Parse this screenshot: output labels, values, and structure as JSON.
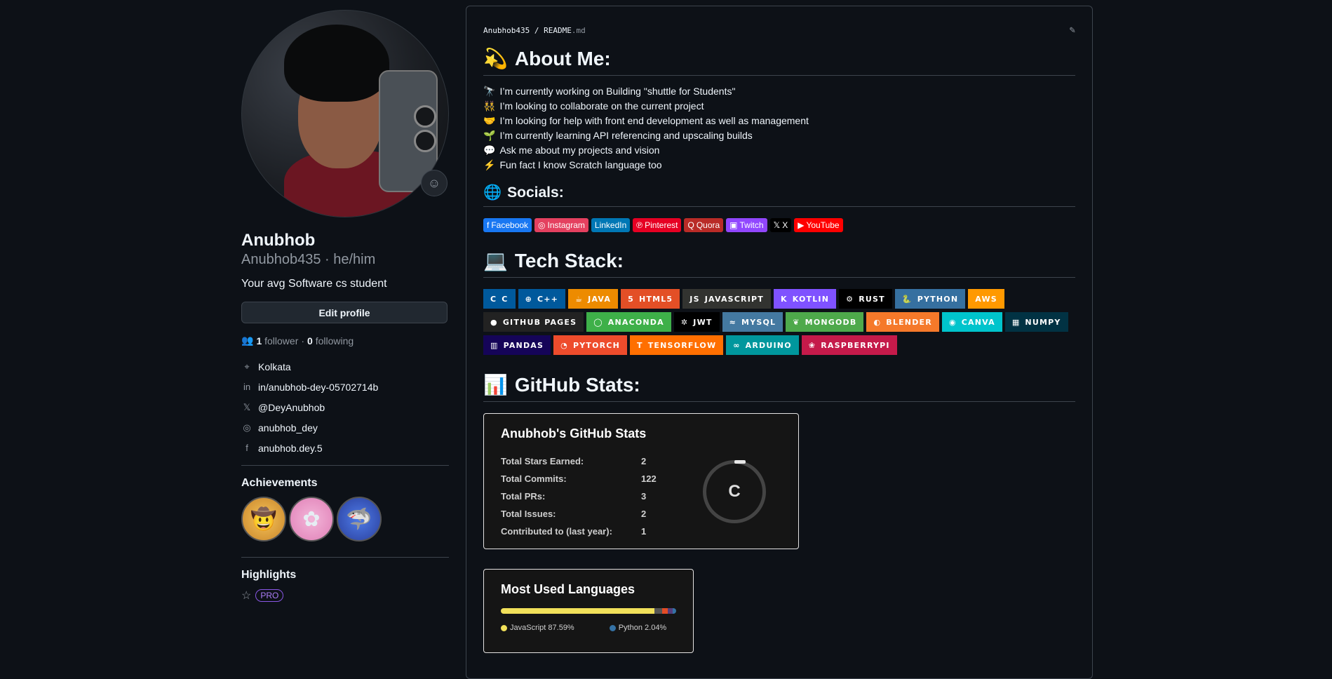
{
  "profile": {
    "name": "Anubhob",
    "login": "Anubhob435",
    "pronouns": "he/him",
    "bio": "Your avg Software cs student",
    "edit_label": "Edit profile",
    "followers_count": "1",
    "followers_label": "follower",
    "following_count": "0",
    "following_label": "following",
    "location": "Kolkata",
    "linkedin": "in/anubhob-dey-05702714b",
    "x_handle": "@DeyAnubhob",
    "instagram": "anubhob_dey",
    "facebook": "anubhob.dey.5",
    "achievements_title": "Achievements",
    "highlights_title": "Highlights",
    "pro_label": "PRO"
  },
  "readme": {
    "owner": "Anubhob435",
    "file": "README",
    "ext": ".md",
    "about_title": "About Me:",
    "about_items": [
      {
        "icon": "🔭",
        "text": "I’m currently working on Building \"shuttle for Students\""
      },
      {
        "icon": "👯",
        "text": "I’m looking to collaborate on the current project"
      },
      {
        "icon": "🤝",
        "text": "I’m looking for help with front end development as well as management"
      },
      {
        "icon": "🌱",
        "text": "I’m currently learning API referencing and upscaling builds"
      },
      {
        "icon": "💬",
        "text": "Ask me about my projects and vision"
      },
      {
        "icon": "⚡",
        "text": "Fun fact I know Scratch language too"
      }
    ],
    "socials_title": "Socials:",
    "socials": [
      {
        "label": "Facebook",
        "color": "#1877F2",
        "icon": "f"
      },
      {
        "label": "Instagram",
        "color": "#E4405F",
        "icon": "◎"
      },
      {
        "label": "LinkedIn",
        "color": "#0077B5",
        "icon": ""
      },
      {
        "label": "Pinterest",
        "color": "#E60023",
        "icon": "℗"
      },
      {
        "label": "Quora",
        "color": "#B92B27",
        "icon": "Q"
      },
      {
        "label": "Twitch",
        "color": "#9146FF",
        "icon": "▣"
      },
      {
        "label": "X",
        "color": "#000000",
        "icon": "𝕏"
      },
      {
        "label": "YouTube",
        "color": "#FF0000",
        "icon": "▶"
      }
    ],
    "tech_title": "Tech Stack:",
    "tech": [
      {
        "label": "C",
        "color": "#00599C",
        "icon": "C"
      },
      {
        "label": "C++",
        "color": "#00599C",
        "icon": "⊕"
      },
      {
        "label": "JAVA",
        "color": "#ED8B00",
        "icon": "☕"
      },
      {
        "label": "HTML5",
        "color": "#E34F26",
        "icon": "5"
      },
      {
        "label": "JAVASCRIPT",
        "color": "#323330",
        "icon": "JS"
      },
      {
        "label": "KOTLIN",
        "color": "#7F52FF",
        "icon": "K"
      },
      {
        "label": "RUST",
        "color": "#000000",
        "icon": "⚙"
      },
      {
        "label": "PYTHON",
        "color": "#3670A0",
        "icon": "🐍"
      },
      {
        "label": "AWS",
        "color": "#FF9900",
        "icon": ""
      },
      {
        "label": "GITHUB PAGES",
        "color": "#222222",
        "icon": "●"
      },
      {
        "label": "ANACONDA",
        "color": "#3EB049",
        "icon": "◯"
      },
      {
        "label": "JWT",
        "color": "#000000",
        "icon": "✲"
      },
      {
        "label": "MYSQL",
        "color": "#4479A1",
        "icon": "≈"
      },
      {
        "label": "MONGODB",
        "color": "#4EA94B",
        "icon": "❦"
      },
      {
        "label": "BLENDER",
        "color": "#F5792A",
        "icon": "◐"
      },
      {
        "label": "CANVA",
        "color": "#00C4CC",
        "icon": "◉"
      },
      {
        "label": "NUMPY",
        "color": "#013243",
        "icon": "▦"
      },
      {
        "label": "PANDAS",
        "color": "#150458",
        "icon": "▥"
      },
      {
        "label": "PYTORCH",
        "color": "#EE4C2C",
        "icon": "◔"
      },
      {
        "label": "TENSORFLOW",
        "color": "#FF6F00",
        "icon": "T"
      },
      {
        "label": "ARDUINO",
        "color": "#00979D",
        "icon": "∞"
      },
      {
        "label": "RASPBERRYPI",
        "color": "#C51A4A",
        "icon": "❀"
      }
    ],
    "stats_title": "GitHub Stats:",
    "stats_card": {
      "title": "Anubhob's GitHub Stats",
      "rows": [
        {
          "label": "Total Stars Earned:",
          "value": "2"
        },
        {
          "label": "Total Commits:",
          "value": "122"
        },
        {
          "label": "Total PRs:",
          "value": "3"
        },
        {
          "label": "Total Issues:",
          "value": "2"
        },
        {
          "label": "Contributed to (last year):",
          "value": "1"
        }
      ],
      "rank": "C"
    },
    "languages_card": {
      "title": "Most Used Languages",
      "langs": [
        {
          "name": "JavaScript",
          "percent": 87.59,
          "label": "JavaScript 87.59%",
          "color": "#f1e05a"
        },
        {
          "name": "Python",
          "percent": 2.04,
          "label": "Python 2.04%",
          "color": "#3572A5"
        }
      ],
      "bar_rest": [
        {
          "percent": 4.5,
          "color": "#555555"
        },
        {
          "percent": 3.0,
          "color": "#e34c26"
        },
        {
          "percent": 2.87,
          "color": "#563d7c"
        }
      ]
    }
  }
}
